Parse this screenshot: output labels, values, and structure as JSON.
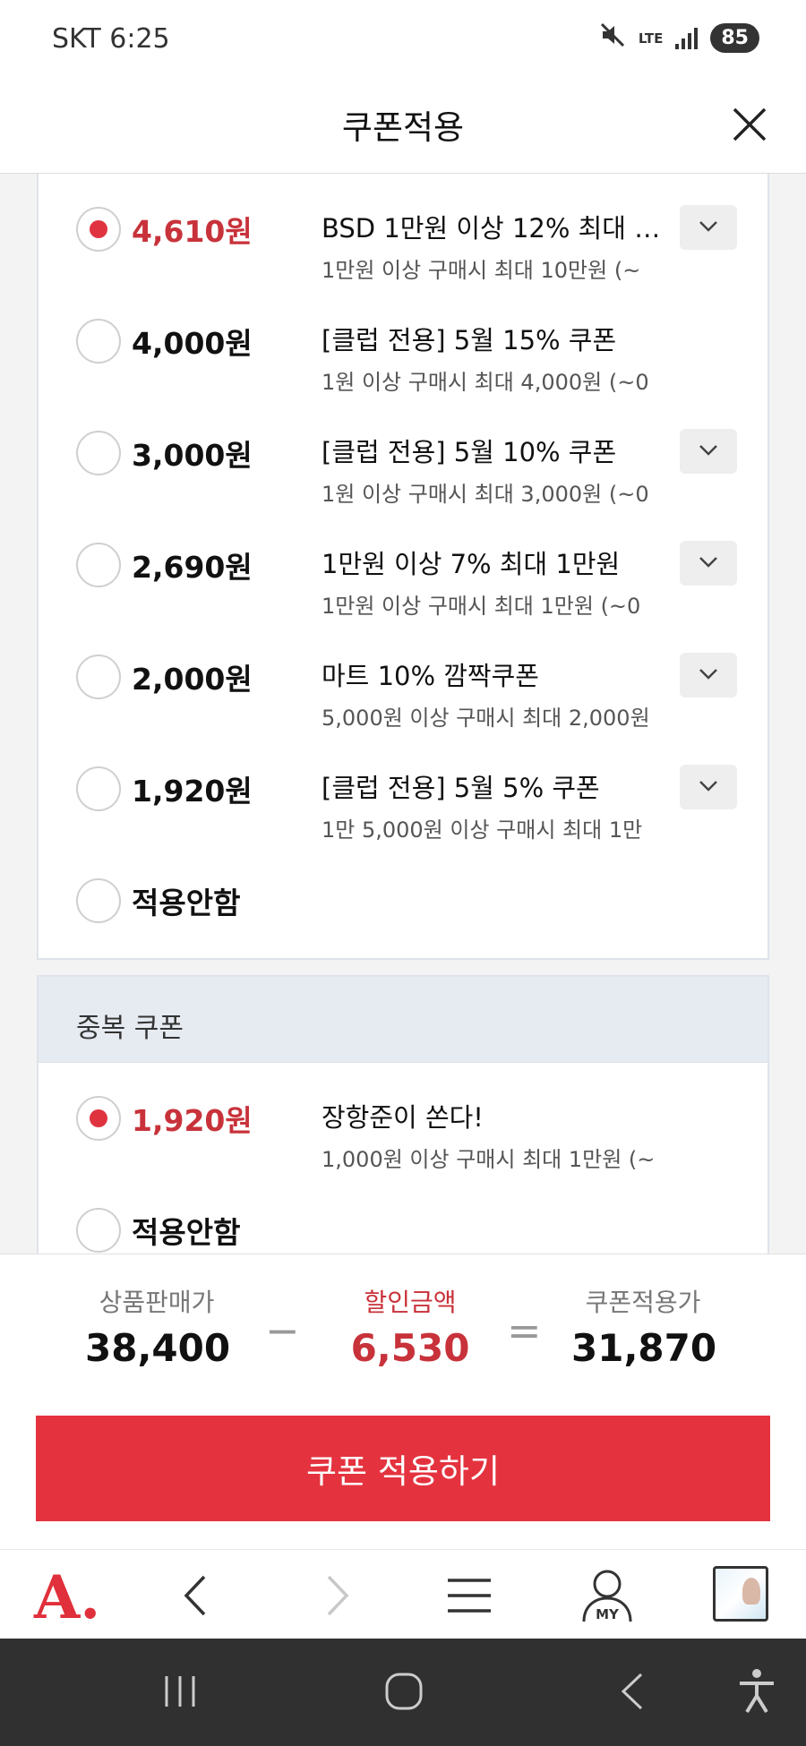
{
  "status_bar": {
    "carrier_time": "SKT 6:25",
    "network": "LTE",
    "battery": "85"
  },
  "header": {
    "title": "쿠폰적용"
  },
  "coupons": [
    {
      "amount": "4,610원",
      "name": "BSD 1만원 이상 12% 최대 1...",
      "desc": "1만원 이상 구매시 최대 10만원 (~",
      "selected": true
    },
    {
      "amount": "4,000원",
      "name": "[클럽 전용] 5월 15% 쿠폰",
      "desc": "1원 이상 구매시 최대 4,000원 (~0",
      "selected": false
    },
    {
      "amount": "3,000원",
      "name": "[클럽 전용] 5월 10% 쿠폰",
      "desc": "1원 이상 구매시 최대 3,000원 (~0",
      "selected": false
    },
    {
      "amount": "2,690원",
      "name": "1만원 이상 7% 최대 1만원",
      "desc": "1만원 이상 구매시 최대 1만원 (~0",
      "selected": false
    },
    {
      "amount": "2,000원",
      "name": "마트 10% 깜짝쿠폰",
      "desc": "5,000원 이상 구매시 최대 2,000원",
      "selected": false
    },
    {
      "amount": "1,920원",
      "name": "[클럽 전용] 5월 5% 쿠폰",
      "desc": "1만 5,000원 이상 구매시 최대 1만",
      "selected": false
    },
    {
      "amount": "적용안함",
      "selected": false
    }
  ],
  "duplicate_section": {
    "title": "중복 쿠폰",
    "coupons": [
      {
        "amount": "1,920원",
        "name": "장항준이 쏜다!",
        "desc": "1,000원 이상 구매시 최대 1만원 (~",
        "selected": true
      },
      {
        "amount": "적용안함",
        "selected": false
      }
    ]
  },
  "summary": {
    "price_label": "상품판매가",
    "price_value": "38,400",
    "minus": "−",
    "discount_label": "할인금액",
    "discount_value": "6,530",
    "equals": "=",
    "final_label": "쿠폰적용가",
    "final_value": "31,870"
  },
  "apply_button": "쿠폰 적용하기",
  "browser_nav": {
    "logo": "A.",
    "my_label": "MY"
  },
  "colors": {
    "accent": "#e4333f",
    "price_red": "#c8323a",
    "section_bg": "#e6eaf1"
  }
}
